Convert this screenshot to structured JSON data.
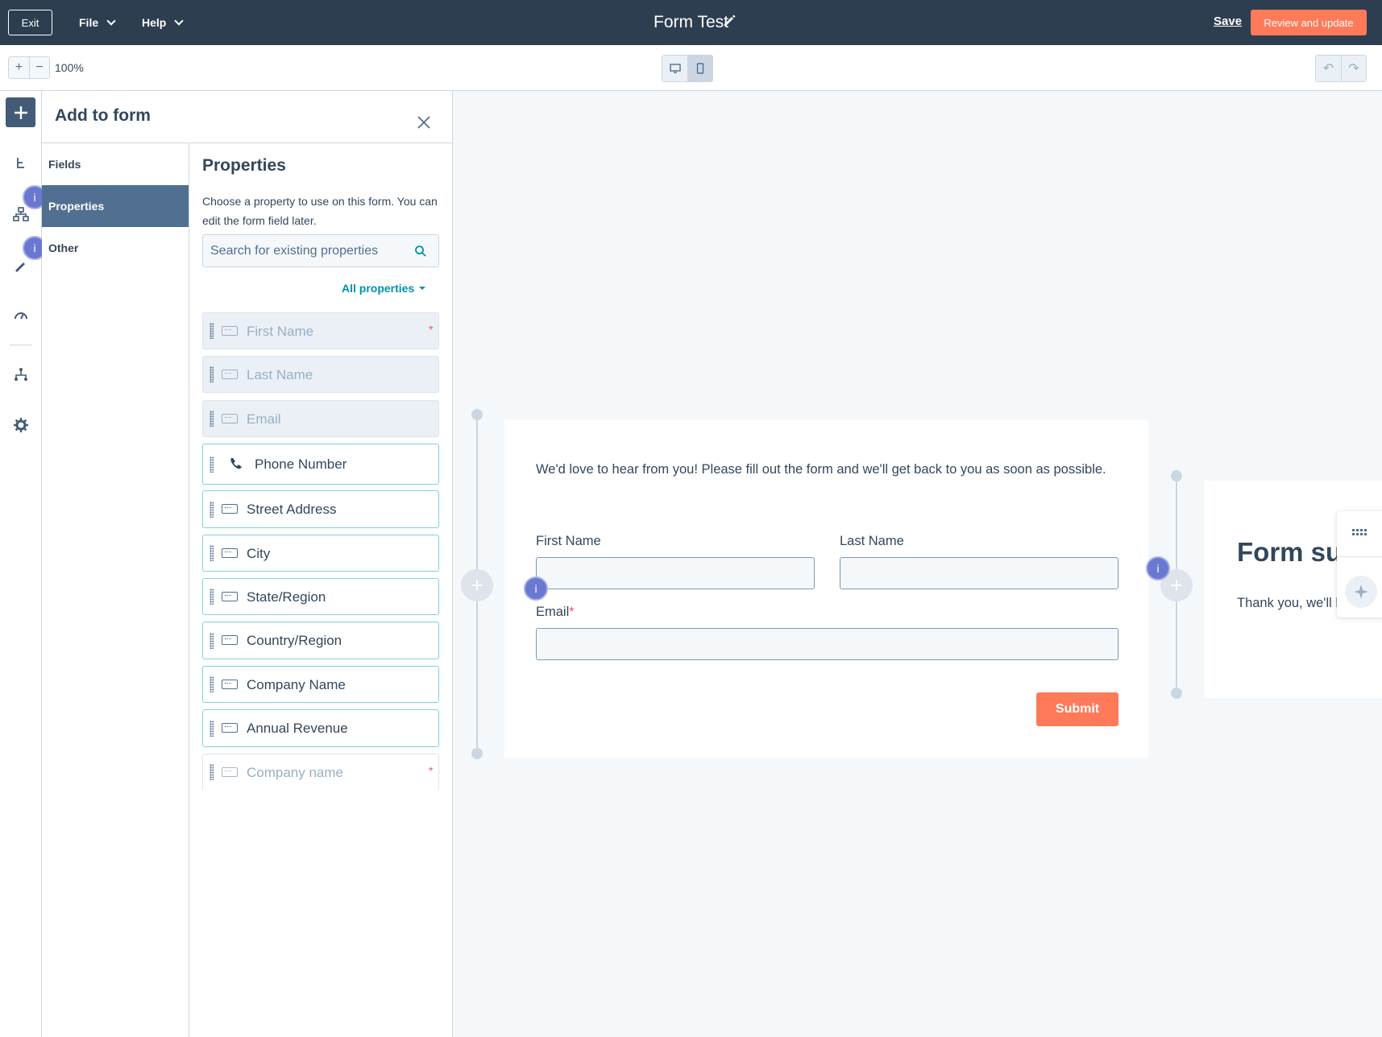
{
  "topbar": {
    "exit_label": "Exit",
    "menus": [
      {
        "label": "File"
      },
      {
        "label": "Help"
      }
    ],
    "title": "Form Test",
    "save_label": "Save",
    "review_label": "Review and update"
  },
  "toolbar": {
    "zoom_in": "+",
    "zoom_out": "−",
    "zoom_level": "100%",
    "devices": [
      "desktop-icon",
      "mobile-icon"
    ],
    "active_device": "mobile",
    "undo": "↶",
    "redo": "↷"
  },
  "rail": {
    "icons": [
      "plus-icon",
      "flow-icon",
      "hierarchy-icon",
      "pencil-icon",
      "gauge-icon",
      "network-icon",
      "gear-icon"
    ]
  },
  "panel": {
    "title": "Add to form",
    "categories": [
      {
        "label": "Fields"
      },
      {
        "label": "Properties"
      },
      {
        "label": "Other"
      }
    ],
    "active_category": "Properties",
    "properties": {
      "title": "Properties",
      "description": "Choose a property to use on this form. You can edit the form field later.",
      "search_placeholder": "Search for existing properties",
      "filter_label": "All properties",
      "items": [
        {
          "label": "First Name",
          "state": "added",
          "required": true
        },
        {
          "label": "Last Name",
          "state": "added",
          "required": false
        },
        {
          "label": "Email",
          "state": "added",
          "required": false
        },
        {
          "label": "Phone Number",
          "state": "available",
          "icon": "phone-icon"
        },
        {
          "label": "Street Address",
          "state": "available"
        },
        {
          "label": "City",
          "state": "available"
        },
        {
          "label": "State/Region",
          "state": "available"
        },
        {
          "label": "Country/Region",
          "state": "available"
        },
        {
          "label": "Company Name",
          "state": "available"
        },
        {
          "label": "Annual Revenue",
          "state": "available"
        },
        {
          "label": "Company name",
          "state": "faded",
          "required": true
        }
      ],
      "required_mark": "*"
    }
  },
  "canvas": {
    "form": {
      "intro": "We'd love to hear from you! Please fill out the form and we'll get back to you as soon as possible.",
      "first_name_label": "First Name",
      "last_name_label": "Last Name",
      "email_label": "Email",
      "required_mark": "*",
      "submit_label": "Submit"
    },
    "thank_you": {
      "title": "Form sub",
      "text": "Thank you, we'll b"
    },
    "info_badge": "i",
    "plus": "+"
  },
  "colors": {
    "topbar": "#2d3e50",
    "accent": "#ff7a59",
    "active_category": "#516f90",
    "link": "#0091ae",
    "info_badge": "#6a78d1"
  }
}
